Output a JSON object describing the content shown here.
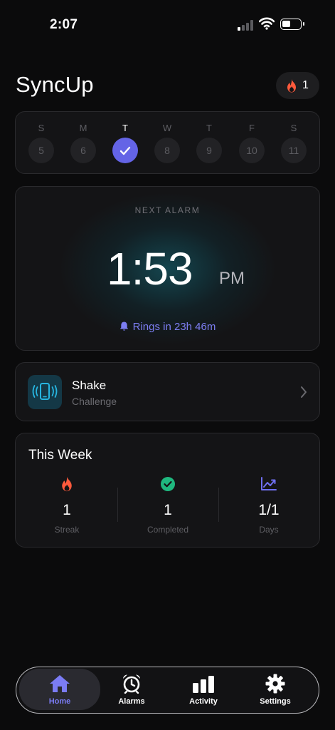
{
  "status_bar": {
    "time": "2:07"
  },
  "header": {
    "title": "SyncUp",
    "streak_count": "1"
  },
  "week_days": [
    {
      "letter": "S",
      "date": "5"
    },
    {
      "letter": "M",
      "date": "6"
    },
    {
      "letter": "T",
      "date": "",
      "selected": true
    },
    {
      "letter": "W",
      "date": "8"
    },
    {
      "letter": "T",
      "date": "9"
    },
    {
      "letter": "F",
      "date": "10"
    },
    {
      "letter": "S",
      "date": "11"
    }
  ],
  "alarm": {
    "label": "NEXT ALARM",
    "time": "1:53",
    "ampm": "PM",
    "rings_in": "Rings in 23h 46m"
  },
  "challenge": {
    "title": "Shake",
    "subtitle": "Challenge"
  },
  "this_week": {
    "title": "This Week",
    "stats": [
      {
        "value": "1",
        "label": "Streak",
        "icon": "flame-icon",
        "color": "#ff5a3c"
      },
      {
        "value": "1",
        "label": "Completed",
        "icon": "check-circle-icon",
        "color": "#1fb87f"
      },
      {
        "value": "1/1",
        "label": "Days",
        "icon": "trend-chart-icon",
        "color": "#6f6ff0"
      }
    ]
  },
  "tabbar": {
    "tabs": [
      {
        "label": "Home",
        "icon": "home-icon",
        "active": true
      },
      {
        "label": "Alarms",
        "icon": "alarm-clock-icon"
      },
      {
        "label": "Activity",
        "icon": "bar-chart-icon"
      },
      {
        "label": "Settings",
        "icon": "gear-icon"
      }
    ]
  },
  "colors": {
    "accent": "#6464e6",
    "accent_text": "#7b7cf5",
    "flame": "#ff5a3c",
    "success": "#1fb87f",
    "background": "#0b0b0c"
  }
}
